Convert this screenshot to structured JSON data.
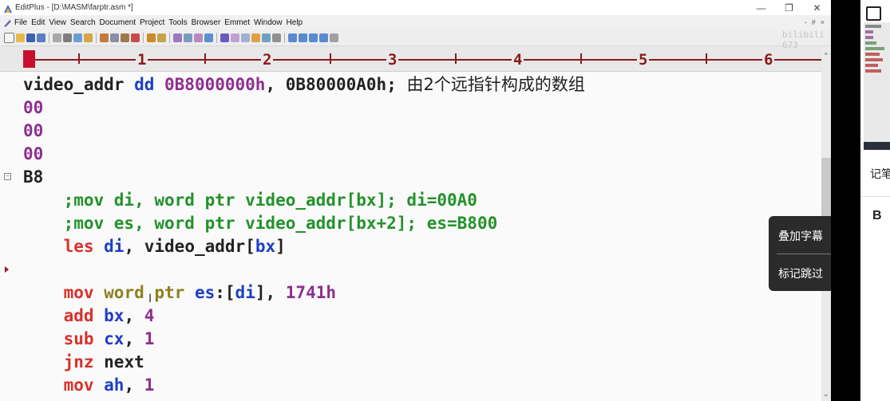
{
  "window": {
    "title": "EditPlus - [D:\\MASM\\farptr.asm *]",
    "controls": [
      "—",
      "❐",
      "✕"
    ]
  },
  "menu": {
    "items": [
      "File",
      "Edit",
      "View",
      "Search",
      "Document",
      "Project",
      "Tools",
      "Browser",
      "Emmet",
      "Window",
      "Help"
    ],
    "mdi_controls": [
      "-",
      "#",
      "×"
    ]
  },
  "ruler": {
    "numbers": [
      "1",
      "2",
      "3",
      "4",
      "5",
      "6"
    ]
  },
  "watermark": "bilibili 673",
  "editor": {
    "lines": [
      [
        {
          "t": "video_addr ",
          "c": "dark"
        },
        {
          "t": "dd ",
          "c": "kw-blue"
        },
        {
          "t": "0B8000000h",
          "c": "num"
        },
        {
          "t": ", ",
          "c": "dark"
        },
        {
          "t": "0B80000A0h",
          "c": "dark"
        },
        {
          "t": "; ",
          "c": "dark"
        },
        {
          "t": "由2个远指针构成的数组",
          "c": "dark cjk"
        }
      ],
      [
        {
          "t": "00",
          "c": "num"
        }
      ],
      [
        {
          "t": "00",
          "c": "num"
        }
      ],
      [
        {
          "t": "00",
          "c": "num"
        }
      ],
      [
        {
          "t": "B8",
          "c": "dark"
        }
      ],
      [
        {
          "t": "    ;mov di, word ptr video_addr[bx]; di=00A0",
          "c": "cmt"
        }
      ],
      [
        {
          "t": "    ;mov es, word ptr video_addr[bx+2]; es=B800",
          "c": "cmt"
        }
      ],
      [
        {
          "t": "    ",
          "c": "dark"
        },
        {
          "t": "les ",
          "c": "kw-red"
        },
        {
          "t": "di",
          "c": "kw-blue"
        },
        {
          "t": ", ",
          "c": "dark"
        },
        {
          "t": "video_addr[",
          "c": "dark"
        },
        {
          "t": "bx",
          "c": "kw-blue"
        },
        {
          "t": "]",
          "c": "dark"
        }
      ],
      [
        {
          "t": "",
          "c": "dark"
        }
      ],
      [
        {
          "t": "    ",
          "c": "dark"
        },
        {
          "t": "mov ",
          "c": "kw-red"
        },
        {
          "t": "word ptr ",
          "c": "kw-olive"
        },
        {
          "t": "es",
          "c": "kw-blue"
        },
        {
          "t": ":[",
          "c": "dark"
        },
        {
          "t": "di",
          "c": "kw-blue"
        },
        {
          "t": "], ",
          "c": "dark"
        },
        {
          "t": "1741h",
          "c": "num"
        }
      ],
      [
        {
          "t": "    ",
          "c": "dark"
        },
        {
          "t": "add ",
          "c": "kw-red"
        },
        {
          "t": "bx",
          "c": "kw-blue"
        },
        {
          "t": ", ",
          "c": "dark"
        },
        {
          "t": "4",
          "c": "num"
        }
      ],
      [
        {
          "t": "    ",
          "c": "dark"
        },
        {
          "t": "sub ",
          "c": "kw-red"
        },
        {
          "t": "cx",
          "c": "kw-blue"
        },
        {
          "t": ", ",
          "c": "dark"
        },
        {
          "t": "1",
          "c": "num"
        }
      ],
      [
        {
          "t": "    ",
          "c": "dark"
        },
        {
          "t": "jnz ",
          "c": "kw-red"
        },
        {
          "t": "next",
          "c": "dark"
        }
      ],
      [
        {
          "t": "    ",
          "c": "dark"
        },
        {
          "t": "mov ",
          "c": "kw-red"
        },
        {
          "t": "ah",
          "c": "kw-blue"
        },
        {
          "t": ", ",
          "c": "dark"
        },
        {
          "t": "1",
          "c": "num"
        }
      ]
    ]
  },
  "overlay_menu": {
    "items": [
      "叠加字幕",
      "标记跳过"
    ]
  },
  "right_panel": {
    "label": "记笔",
    "bold_label": "B"
  }
}
